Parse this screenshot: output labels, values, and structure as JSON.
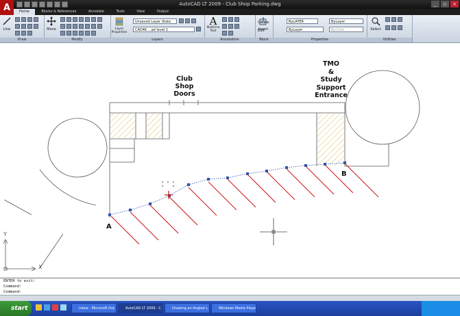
{
  "window": {
    "title": "AutoCAD LT 2009 - Club Shop Parking.dwg",
    "app_letter": "A"
  },
  "tabs": [
    "Home",
    "Blocks & References",
    "Annotate",
    "Tools",
    "View",
    "Output"
  ],
  "ribbon": {
    "panels": [
      "Draw",
      "Modify",
      "Layers",
      "Annotation",
      "Block",
      "Properties",
      "Utilities"
    ],
    "draw": {
      "line": "Line"
    },
    "modify": {
      "move": "Move"
    },
    "layers": {
      "layer_properties": "Layer Properties",
      "layer_state": "Unsaved Layer State",
      "layer_current": "CAD4K ...ad level 1"
    },
    "annotation": {
      "multiline_text": "Multiline Text"
    },
    "block": {
      "insert": "Insert",
      "create": "Create",
      "edit": "Edit"
    },
    "properties": {
      "color": "ByLAYER",
      "linetype": "ByLayer",
      "lineweight": "ByLayer",
      "plotstyle": "ByColor"
    },
    "utilities": {
      "select": "Select"
    }
  },
  "drawing": {
    "label_club": [
      "Club",
      "Shop",
      "Doors"
    ],
    "label_tmo": [
      "TMO",
      "&",
      "Study",
      "Support",
      "Entrance"
    ],
    "point_a": "A",
    "point_b": "B",
    "ucs_x": "X",
    "ucs_y": "Y"
  },
  "command": {
    "history1": "ENTER to exit:",
    "history2": "Command:",
    "prompt": "Command:"
  },
  "taskbar": {
    "start": "start",
    "items": [
      "Inbox - Microsoft Out...",
      "AutoCAD LT 2009 - C...",
      "Drawing an Angled L...",
      "Windows Media Player"
    ]
  }
}
